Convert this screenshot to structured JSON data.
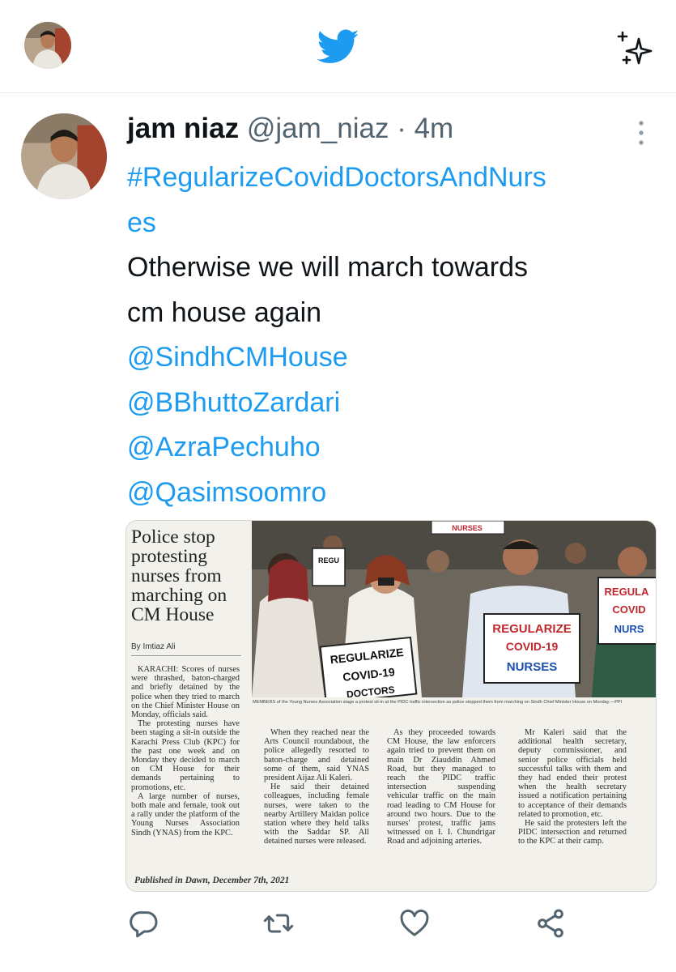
{
  "top_bar": {
    "profile_icon": "user-avatar",
    "logo_icon": "twitter-bird-icon",
    "sparkle_icon": "sparkle-icon"
  },
  "tweet": {
    "name": "jam niaz",
    "handle": "@jam_niaz",
    "separator": "·",
    "time": "4m",
    "hashtag_line1": "#RegularizeCovidDoctorsAndNurs",
    "hashtag_line2": "es",
    "text_line1": "Otherwise we will march towards",
    "text_line2": "cm house again",
    "mentions": [
      "@SindhCMHouse",
      "@BBhuttoZardari",
      "@AzraPechuho",
      "@Qasimsoomro"
    ]
  },
  "article": {
    "headline": "Police stop protesting nurses from marching on CM House",
    "byline": "By Imtiaz Ali",
    "photo_signs": [
      "REGULARIZE COVID-19 NURSES",
      "REGULARIZE COVID-19 DOCTORS",
      "REGULA COVID NURS",
      "REGU",
      "NURSES"
    ],
    "caption": "MEMBERS of the Young Nurses Association stage a protest sit-in at the PIDC traffic intersection as police stopped them from marching on Sindh Chief Minister House on Monday.—PPI",
    "col1": [
      "KARACHI: Scores of nurses were thrashed, baton-charged and briefly detained by the police when they tried to march on the Chief Minister House on Monday, officials said.",
      "The protesting nurses have been staging a sit-in outside the Karachi Press Club (KPC) for the past one week and on Monday they decided to march on CM House for their demands pertaining to promotions, etc.",
      "A large number of nurses, both male and female, took out a rally under the platform of the Young Nurses Association Sindh (YNAS) from the KPC."
    ],
    "col2": [
      "When they reached near the Arts Council roundabout, the police allegedly resorted to baton-charge and detained some of them, said YNAS president Aijaz Ali Kaleri.",
      "He said their detained colleagues, including female nurses, were taken to the nearby Artillery Maidan police station where they held talks with the Saddar SP. All detained nurses were released."
    ],
    "col3": [
      "As they proceeded towards CM House, the law enforcers again tried to prevent them on main Dr Ziauddin Ahmed Road, but they managed to reach the PIDC traffic intersection suspending vehicular traffic on the main road leading to CM House for around two hours. Due to the nurses' protest, traffic jams witnessed on I. I. Chundrigar Road and adjoining arteries."
    ],
    "col4": [
      "Mr Kaleri said that the additional health secretary, deputy commissioner, and senior police officials held successful talks with them and they had ended their protest when the health secretary issued a notification pertaining to acceptance of their demands related to promotion, etc.",
      "He said the protesters left the PIDC intersection and returned to the KPC at their camp."
    ],
    "published": "Published in Dawn, December 7th, 2021"
  },
  "actions": {
    "reply_icon": "reply-icon",
    "retweet_icon": "retweet-icon",
    "like_icon": "heart-icon",
    "share_icon": "share-icon"
  },
  "colors": {
    "link": "#1d9bf0",
    "text": "#0f1419",
    "muted": "#536471"
  }
}
